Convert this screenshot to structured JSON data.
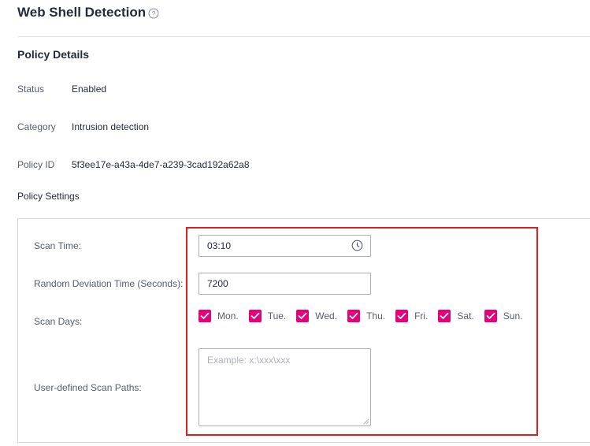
{
  "header": {
    "title": "Web Shell Detection",
    "help_icon": "question-circle-icon"
  },
  "policy_details": {
    "title": "Policy Details",
    "status": {
      "label": "Status",
      "value": "Enabled"
    },
    "category": {
      "label": "Category",
      "value": "Intrusion detection"
    },
    "policy_id": {
      "label": "Policy ID",
      "value": "5f3ee17e-a43a-4de7-a239-3cad192a62a8"
    }
  },
  "policy_settings": {
    "title": "Policy Settings",
    "scan_time": {
      "label": "Scan Time:",
      "value": "03:10",
      "icon": "clock-icon"
    },
    "random_deviation": {
      "label": "Random Deviation Time (Seconds):",
      "value": "7200"
    },
    "scan_days": {
      "label": "Scan Days:",
      "days": [
        {
          "label": "Mon.",
          "checked": true
        },
        {
          "label": "Tue.",
          "checked": true
        },
        {
          "label": "Wed.",
          "checked": true
        },
        {
          "label": "Thu.",
          "checked": true
        },
        {
          "label": "Fri.",
          "checked": true
        },
        {
          "label": "Sat.",
          "checked": true
        },
        {
          "label": "Sun.",
          "checked": true
        }
      ]
    },
    "scan_paths": {
      "label": "User-defined Scan Paths:",
      "value": "",
      "placeholder": "Example: x:\\xxx\\xxx"
    }
  },
  "colors": {
    "accent": "#e6007a",
    "highlight": "#e01e1e",
    "border": "#adb0b8"
  }
}
